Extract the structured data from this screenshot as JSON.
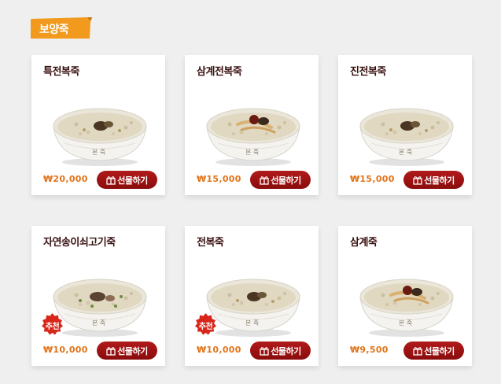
{
  "section": {
    "label": "보양죽"
  },
  "colors": {
    "accent": "#f19a1d",
    "button": "#9b1010",
    "price": "#e0741a",
    "badge": "#d8271a"
  },
  "products": [
    {
      "name": "특전복죽",
      "price": "₩20,000",
      "button": "선물하기",
      "topping": "abalone"
    },
    {
      "name": "삼계전복죽",
      "price": "₩15,000",
      "button": "선물하기",
      "topping": "ginseng"
    },
    {
      "name": "진전복죽",
      "price": "₩15,000",
      "button": "선물하기",
      "topping": "abalone"
    },
    {
      "name": "자연송이쇠고기죽",
      "price": "₩10,000",
      "button": "선물하기",
      "badge": "추천",
      "topping": "mushroom"
    },
    {
      "name": "전복죽",
      "price": "₩10,000",
      "button": "선물하기",
      "badge": "추천",
      "topping": "abalone"
    },
    {
      "name": "삼계죽",
      "price": "₩9,500",
      "button": "선물하기",
      "topping": "ginseng"
    }
  ]
}
